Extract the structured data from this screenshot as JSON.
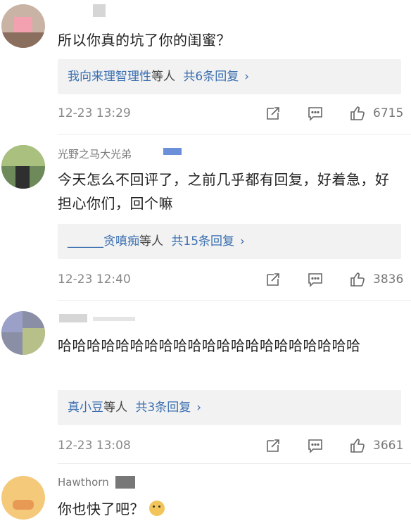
{
  "comments": [
    {
      "username": "",
      "text": "所以你真的坑了你的闺蜜？",
      "reply_users": "我向来理智理性",
      "reply_suffix": "等人",
      "reply_count": "共6条回复",
      "chevron": "›",
      "time": "12-23 13:29",
      "likes": "6715"
    },
    {
      "username": "光野之马大光弟",
      "text": "今天怎么不回评了，之前几乎都有回复，好着急，好担心你们，回个嘛",
      "reply_users": "______贪嗔痴",
      "reply_suffix": "等人",
      "reply_count": "共15条回复",
      "chevron": "›",
      "time": "12-23 12:40",
      "likes": "3836"
    },
    {
      "username": "",
      "text": "哈哈哈哈哈哈哈哈哈哈哈哈哈哈哈哈哈哈哈哈哈",
      "reply_users": "真小豆",
      "reply_suffix": "等人",
      "reply_count": "共3条回复",
      "chevron": "›",
      "time": "12-23 13:08",
      "likes": "3661"
    },
    {
      "username": "Hawthorn",
      "text": "你也快了吧？",
      "emoji": "dog-face-emoji"
    }
  ],
  "icons": {
    "share": "share-icon",
    "comment": "comment-icon",
    "like": "thumbs-up-icon"
  },
  "colors": {
    "link": "#3b6fb0",
    "reply_bg": "#f2f2f2",
    "meta": "#888888"
  }
}
